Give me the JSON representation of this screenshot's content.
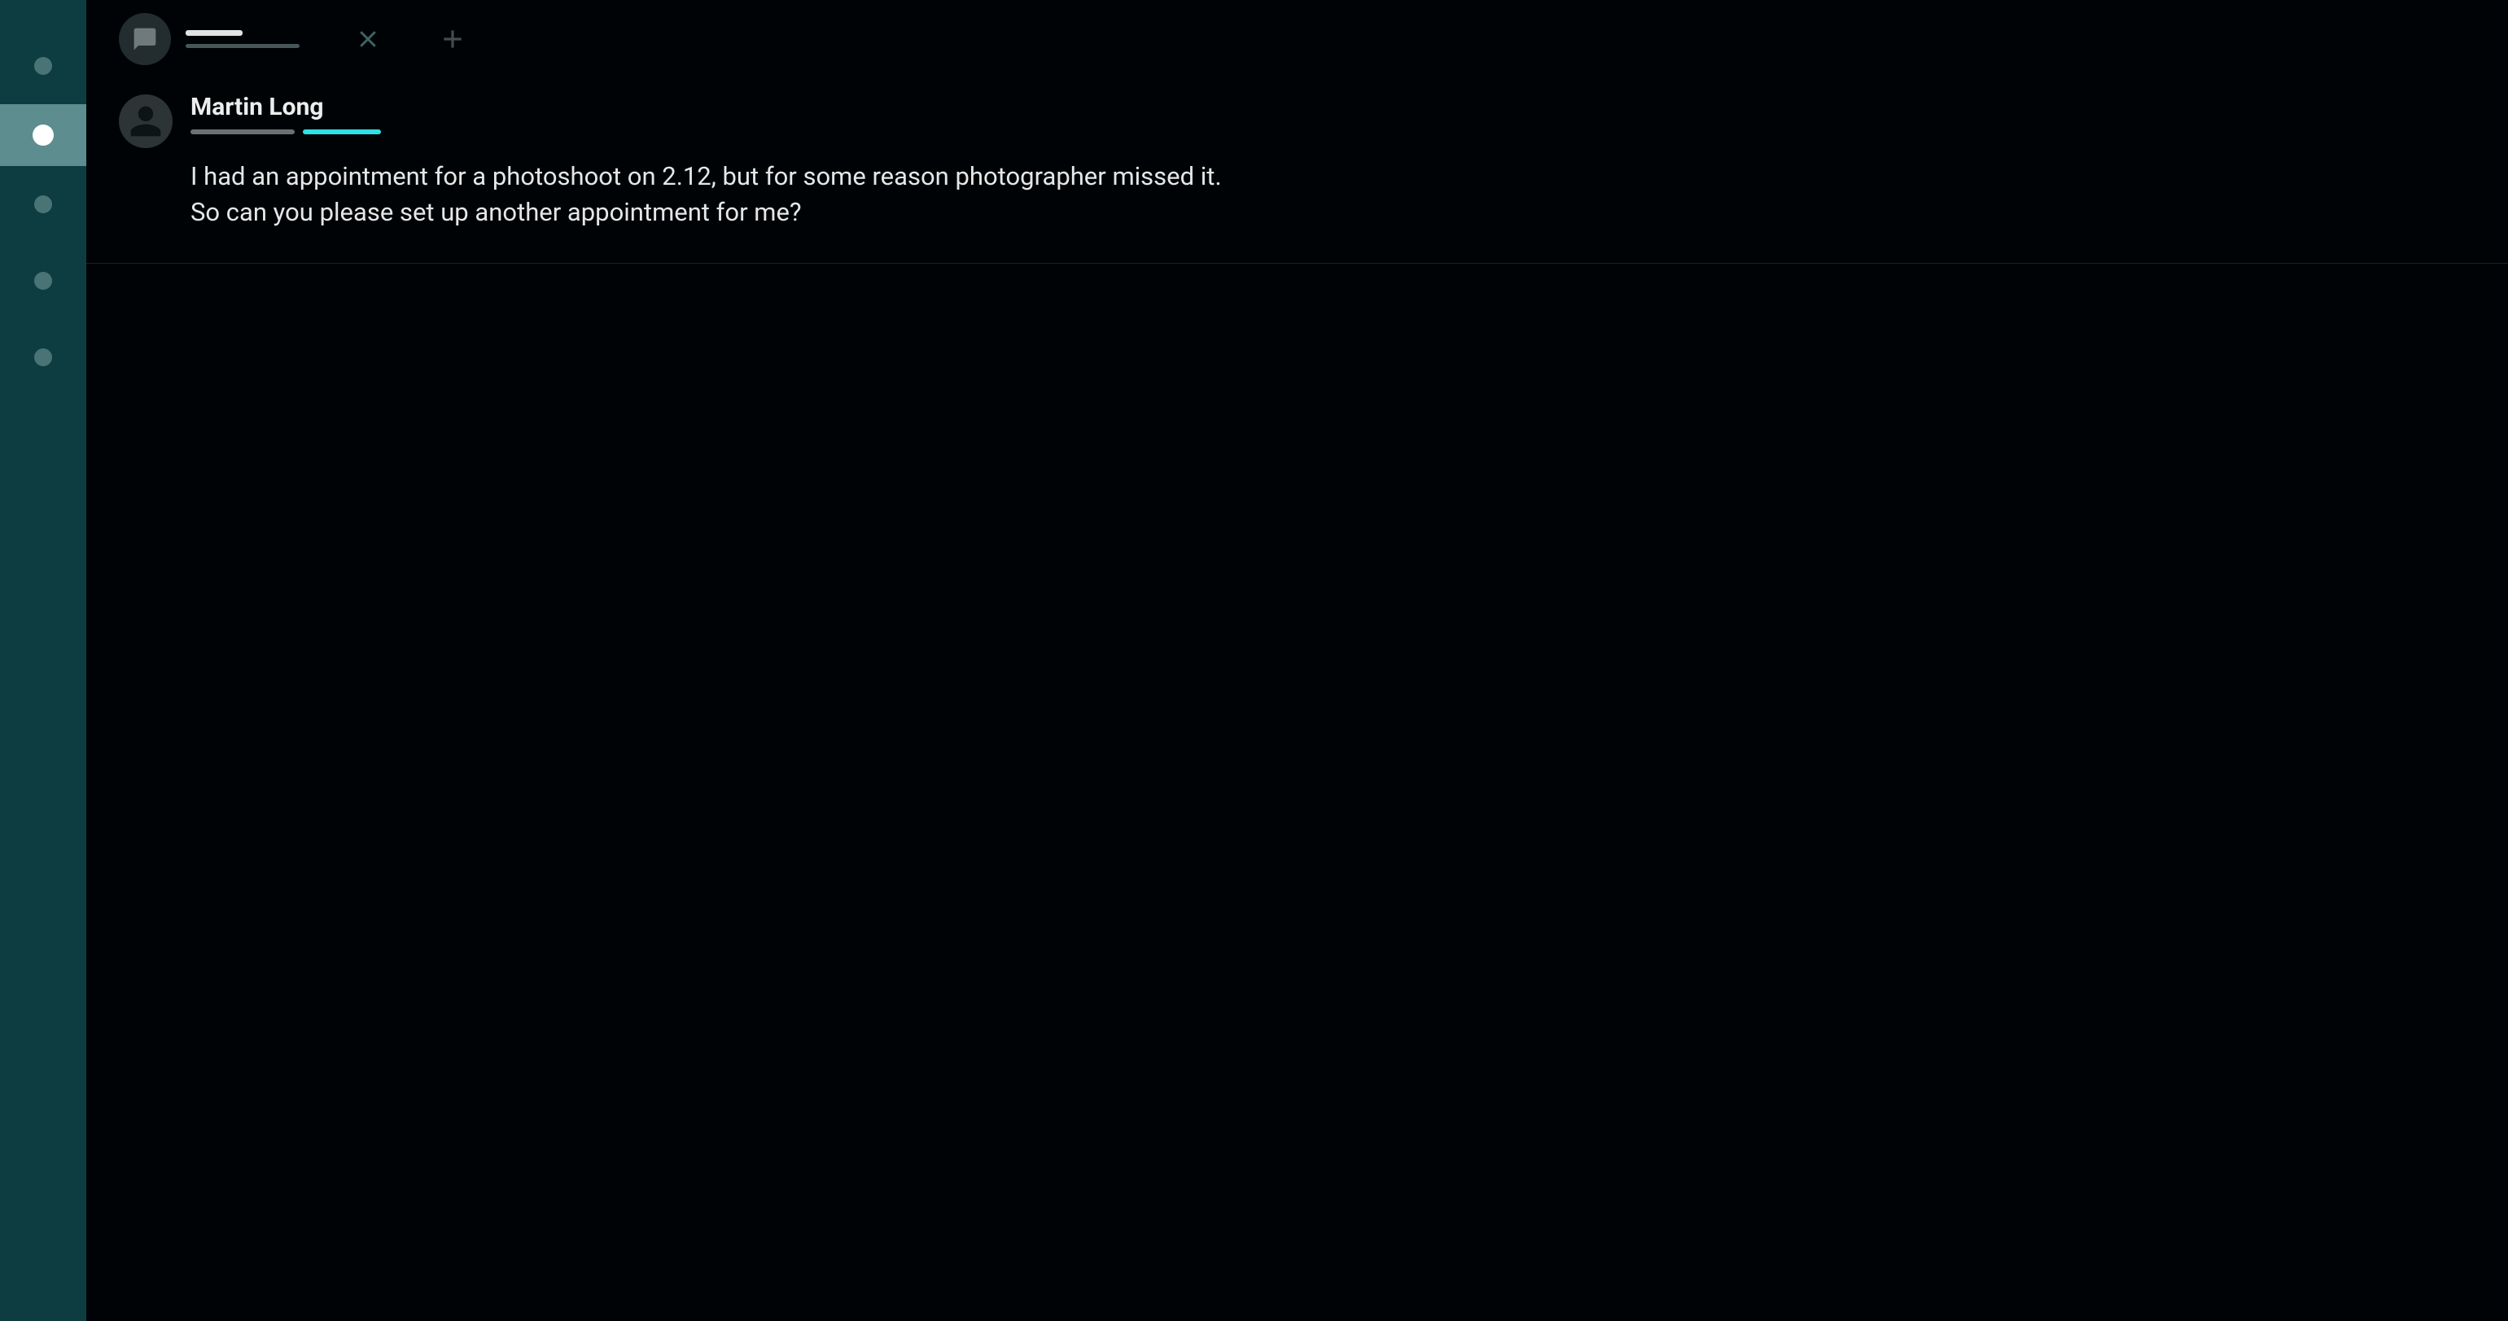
{
  "nav": {
    "items": [
      {
        "active": false
      },
      {
        "active": true
      },
      {
        "active": false
      },
      {
        "active": false
      },
      {
        "active": false
      }
    ]
  },
  "tab": {
    "close_label": "Close",
    "add_label": "New tab"
  },
  "message": {
    "sender": "Martin Long",
    "text": "I had an appointment for a photoshoot on 2.12, but for some reason photographer missed it.\nSo can you please set up another appointment for me?"
  },
  "colors": {
    "rail": "#0d3d41",
    "rail_active": "#5d8d8f",
    "accent": "#2fe0e5",
    "bg": "#000306"
  }
}
